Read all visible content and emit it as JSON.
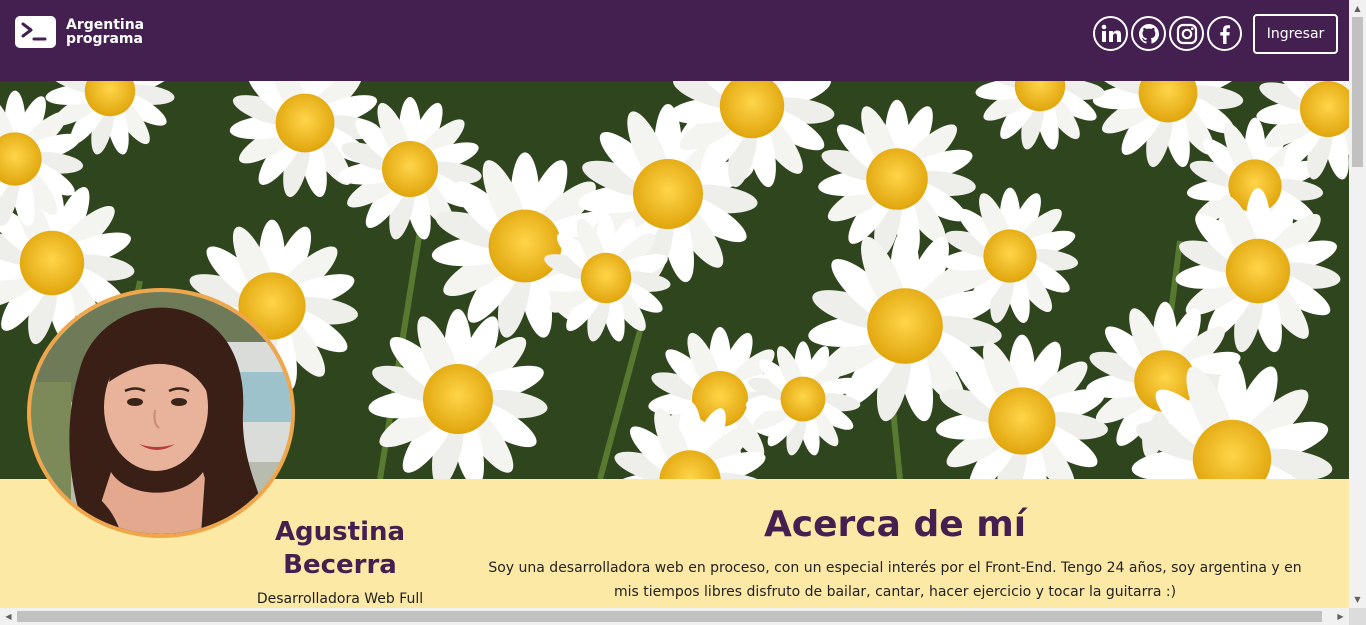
{
  "header": {
    "logo_line1": "Argentina",
    "logo_line2": "programa",
    "social": [
      {
        "name": "linkedin-icon",
        "glyph": "in"
      },
      {
        "name": "github-icon"
      },
      {
        "name": "instagram-icon"
      },
      {
        "name": "facebook-icon",
        "glyph": "f"
      }
    ],
    "login_label": "Ingresar"
  },
  "profile": {
    "name": "Agustina Becerra",
    "role": "Desarrolladora Web Full"
  },
  "about": {
    "title": "Acerca de mí",
    "text": "Soy una desarrolladora web en proceso, con un especial interés por el Front-End. Tengo 24 años, soy argentina y en mis tiempos libres disfruto de bailar, cantar, hacer ejercicio y tocar la guitarra :)"
  },
  "colors": {
    "header_bg": "#43204f",
    "content_bg": "#fde9a6",
    "avatar_border": "#f0a64a",
    "heading": "#43204f"
  }
}
